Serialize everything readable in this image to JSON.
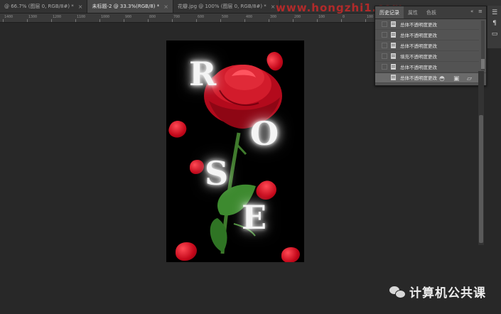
{
  "tabs": [
    {
      "label": "@ 66.7% (图层 0, RGB/8#) *",
      "close": "×"
    },
    {
      "label": "未标题-2 @ 33.3%(RGB/8) *",
      "close": "×"
    },
    {
      "label": "花瓣.jpg @ 100% (图层 0, RGB/8#) *",
      "close": "×"
    }
  ],
  "watermark": "www.hongzhi1.com",
  "ruler_ticks": [
    "1400",
    "1300",
    "1200",
    "1100",
    "1000",
    "900",
    "800",
    "700",
    "600",
    "500",
    "400",
    "300",
    "200",
    "100",
    "0",
    "100",
    "200",
    "300",
    "400",
    "500",
    "600",
    "700",
    "800",
    "900",
    "1000",
    "1100",
    "1200",
    "1300",
    "1400"
  ],
  "canvas": {
    "letters": [
      "R",
      "O",
      "S",
      "E"
    ]
  },
  "history_panel": {
    "tabs": [
      "历史记录",
      "属性",
      "色板"
    ],
    "controls": {
      "collapse": "«",
      "menu": "≡"
    },
    "items": [
      {
        "label": "总体不透明度更改"
      },
      {
        "label": "总体不透明度更改"
      },
      {
        "label": "总体不透明度更改"
      },
      {
        "label": "填充不透明度更改"
      },
      {
        "label": "总体不透明度更改"
      },
      {
        "label": "总体不透明度更改"
      }
    ],
    "footer_icons": [
      "new-snapshot-from-state-icon",
      "camera-icon",
      "trash-icon"
    ]
  },
  "right_toolbar": {
    "icons": [
      "history-icon",
      "paragraph-icon",
      "comment-icon"
    ]
  },
  "brand": {
    "text": "计算机公共课"
  },
  "colors": {
    "accent_red": "#c4081a",
    "panel_bg": "#535353",
    "app_bg": "#282828"
  }
}
